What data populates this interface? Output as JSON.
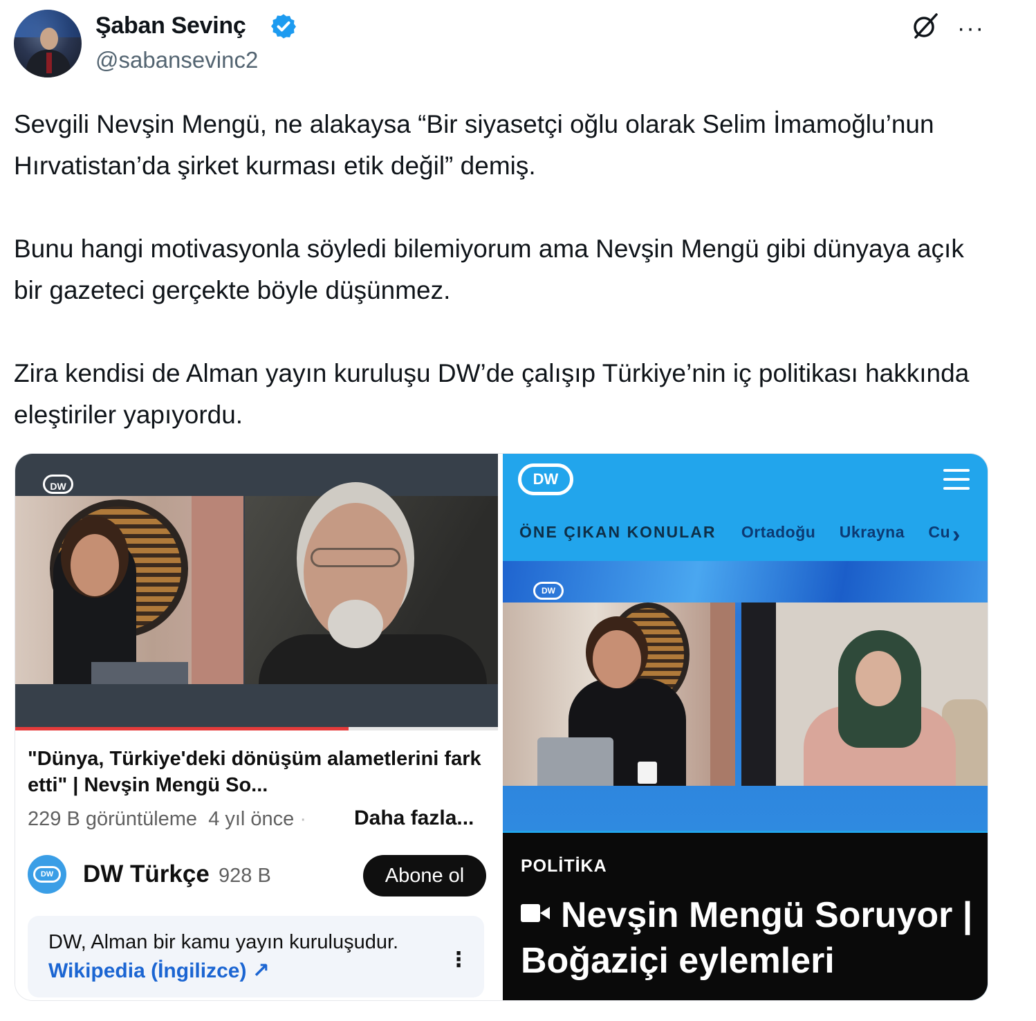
{
  "author": {
    "name": "Şaban Sevinç",
    "handle": "@sabansevinc2",
    "verified": true,
    "verified_color": "#1d9bf0"
  },
  "actions": {
    "grok_icon": "grok-icon",
    "more_icon": "more-icon",
    "more_glyph": "···"
  },
  "tweet": {
    "paragraphs": [
      "Sevgili Nevşin Mengü, ne alakaysa “Bir siyasetçi oğlu olarak Selim İmamoğlu’nun Hırvatistan’da şirket kurması etik değil” demiş.",
      "Bunu hangi motivasyonla söyledi bilemiyorum ama Nevşin Mengü gibi dünyaya açık bir gazeteci gerçekte böyle düşünmez.",
      "Zira kendisi de Alman yayın kuruluşu DW’de çalışıp Türkiye’nin iç politikası hakkında eleştiriler yapıyordu."
    ]
  },
  "media_left": {
    "badge": "DW",
    "video_title": "\"Dünya, Türkiye'deki dönüşüm alametlerini fark etti\" | Nevşin Mengü So...",
    "views": "229 B görüntüleme",
    "age": "4 yıl önce",
    "sep": " ·",
    "more_label": "Daha fazla...",
    "channel": {
      "avatar_text": "DW",
      "name": "DW Türkçe",
      "subscribers": "928 B",
      "subscribe_label": "Abone ol"
    },
    "info": {
      "text": "DW, Alman bir kamu yayın kuruluşudur.",
      "link": "Wikipedia (İngilizce) ↗",
      "menu_glyph": "⋮"
    },
    "progress_fraction": 0.69,
    "progress_color": "#e53b3b"
  },
  "media_right": {
    "logo": "DW",
    "nav": {
      "featured_label": "ÖNE ÇIKAN KONULAR",
      "topics": [
        "Ortadoğu",
        "Ukrayna",
        "Cu"
      ],
      "chevron": "›"
    },
    "badge": "DW",
    "category": "POLİTİKA",
    "headline": "Nevşin Mengü Soruyor | Boğaziçi eylemleri",
    "accent_color": "#22a5ec"
  }
}
